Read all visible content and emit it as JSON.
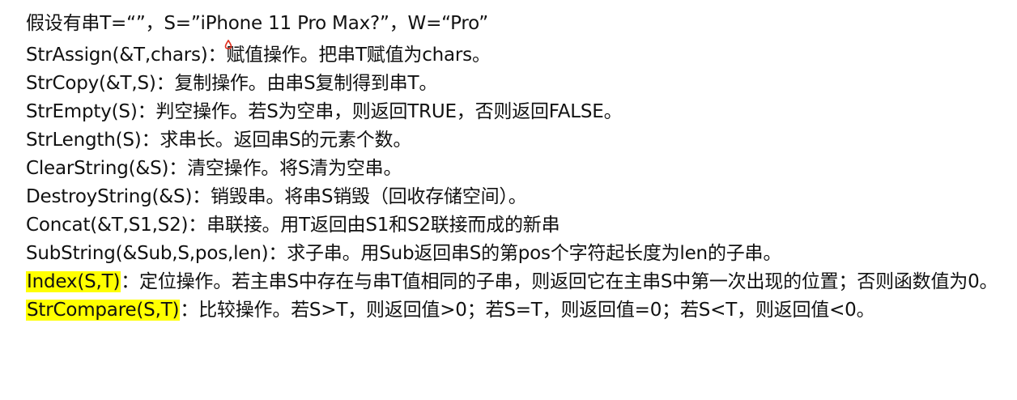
{
  "header": "假设有串T=“”，S=”iPhone 11 Pro Max?”，W=“Pro”",
  "operations": [
    {
      "func": "StrAssign(&T,chars)",
      "desc": "：赋值操作。把串T赋值为chars。",
      "highlight": false
    },
    {
      "func": "StrCopy(&T,S)",
      "desc": "：复制操作。由串S复制得到串T。",
      "highlight": false
    },
    {
      "func": "StrEmpty(S)",
      "desc": "：判空操作。若S为空串，则返回TRUE，否则返回FALSE。",
      "highlight": false
    },
    {
      "func": "StrLength(S)",
      "desc": "：求串长。返回串S的元素个数。",
      "highlight": false
    },
    {
      "func": "ClearString(&S)",
      "desc": "：清空操作。将S清为空串。",
      "highlight": false
    },
    {
      "func": "DestroyString(&S)",
      "desc": "：销毁串。将串S销毁（回收存储空间）。",
      "highlight": false
    },
    {
      "func": "Concat(&T,S1,S2)",
      "desc": "：串联接。用T返回由S1和S2联接而成的新串",
      "highlight": false
    },
    {
      "func": "SubString(&Sub,S,pos,len)",
      "desc": "：求子串。用Sub返回串S的第pos个字符起长度为len的子串。",
      "highlight": false
    },
    {
      "func": "Index(S,T)",
      "desc": "：定位操作。若主串S中存在与串T值相同的子串，则返回它在主串S中第一次出现的位置；否则函数值为0。",
      "highlight": true
    },
    {
      "func": "StrCompare(S,T)",
      "desc": "：比较操作。若S>T，则返回值>0；若S=T，则返回值=0；若S<T，则返回值<0。",
      "highlight": true
    }
  ],
  "colors": {
    "highlight": "#ffff00",
    "text": "#111111",
    "caret_mark": "#e03020"
  }
}
